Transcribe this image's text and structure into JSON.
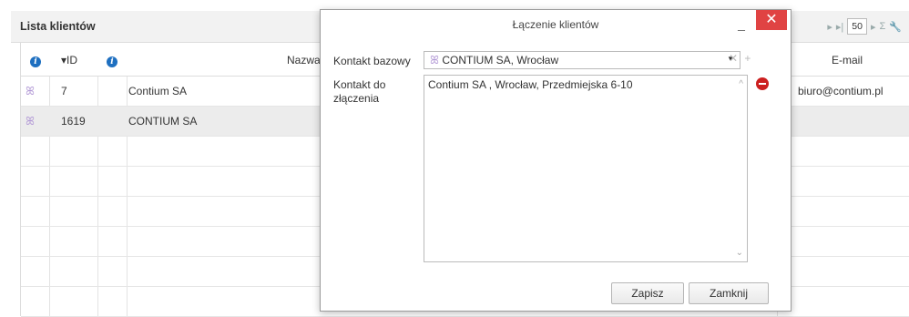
{
  "panel": {
    "title": "Lista klientów",
    "pager": {
      "first": "▸",
      "last": "▸|",
      "page_size": "50",
      "next": "▸",
      "sum": "Σ",
      "tools": "🔧"
    }
  },
  "grid": {
    "headers": {
      "id": "ID",
      "sort_arrow": "▾",
      "name": "Nazwa",
      "email": "E-mail"
    },
    "rows": [
      {
        "id": "7",
        "name": "Contium SA",
        "email": "biuro@contium.pl"
      },
      {
        "id": "1619",
        "name": "CONTIUM SA",
        "email": ""
      }
    ]
  },
  "modal": {
    "title": "Łączenie klientów",
    "minimize": "_",
    "close": "✕",
    "base_label": "Kontakt bazowy",
    "base_value": "CONTIUM SA, Wrocław",
    "merge_label": "Kontakt do złączenia",
    "merge_item": "Contium SA , Wrocław, Przedmiejska 6-10",
    "save": "Zapisz",
    "close_btn": "Zamknij"
  }
}
